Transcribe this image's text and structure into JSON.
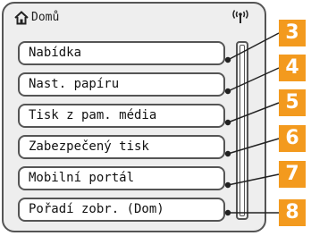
{
  "status_bar": {
    "home_icon": "home-icon",
    "home_label": "Domů",
    "wireless_icon": "wireless-signal-icon"
  },
  "menu": {
    "items": [
      {
        "label": "Nabídka",
        "callout": "3"
      },
      {
        "label": "Nast. papíru",
        "callout": "4"
      },
      {
        "label": "Tisk z pam. média",
        "callout": "5"
      },
      {
        "label": "Zabezpečený tisk",
        "callout": "6"
      },
      {
        "label": "Mobilní portál",
        "callout": "7"
      },
      {
        "label": "Pořadí zobr. (Dom)",
        "callout": "8"
      }
    ]
  },
  "colors": {
    "callout_bg": "#f39a1e",
    "screen_bg": "#eeeeee",
    "border": "#555555"
  }
}
